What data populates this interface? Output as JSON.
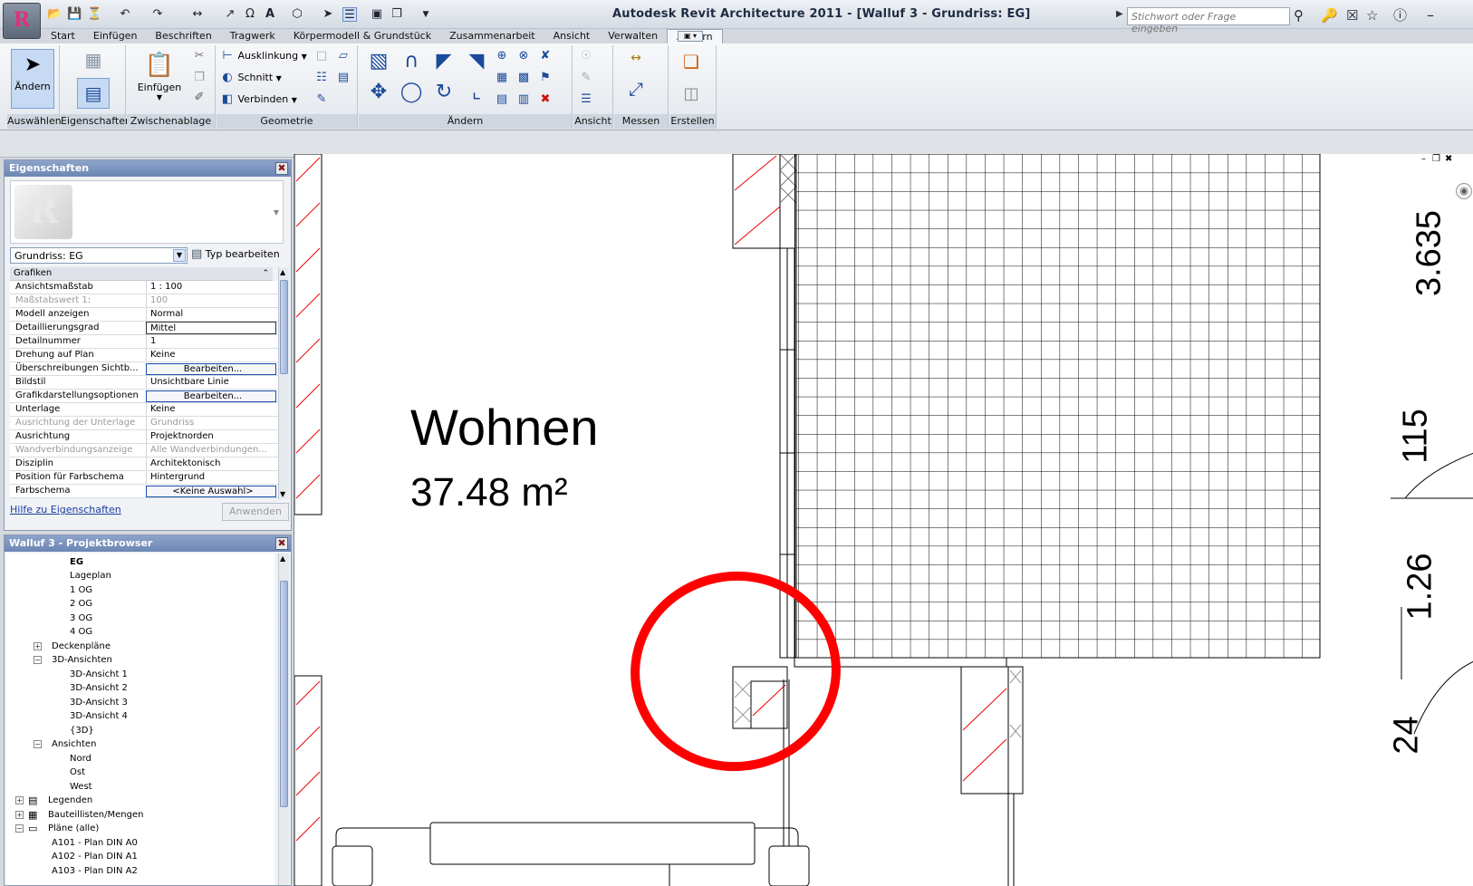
{
  "app": {
    "logo": "R",
    "title": "Autodesk Revit Architecture 2011 - [Walluf 3 - Grundriss: EG]",
    "search_placeholder": "Stichwort oder Frage eingeben"
  },
  "tabs": [
    "Start",
    "Einfügen",
    "Beschriften",
    "Tragwerk",
    "Körpermodell & Grundstück",
    "Zusammenarbeit",
    "Ansicht",
    "Verwalten",
    "Ändern"
  ],
  "ribbon": {
    "panels": [
      "Auswählen",
      "Eigenschaften",
      "Zwischenablage",
      "Geometrie",
      "Ändern",
      "Ansicht",
      "Messen",
      "Erstellen"
    ],
    "aendern_button": "Ändern",
    "einfuegen_button": "Einfügen",
    "geometrie_items": [
      "Ausklinkung",
      "Schnitt",
      "Verbinden"
    ]
  },
  "properties": {
    "title": "Eigenschaften",
    "type_selector": "Grundriss: EG",
    "edit_type": "Typ bearbeiten",
    "group": "Grafiken",
    "rows": [
      {
        "name": "Ansichtsmaßstab",
        "value": "1 : 100"
      },
      {
        "name": "Maßstabswert 1:",
        "value": "100"
      },
      {
        "name": "Modell anzeigen",
        "value": "Normal"
      },
      {
        "name": "Detaillierungsgrad",
        "value": "Mittel"
      },
      {
        "name": "Detailnummer",
        "value": "1"
      },
      {
        "name": "Drehung auf Plan",
        "value": "Keine"
      },
      {
        "name": "Überschreibungen Sichtb...",
        "value": "Bearbeiten..."
      },
      {
        "name": "Bildstil",
        "value": "Unsichtbare Linie"
      },
      {
        "name": "Grafikdarstellungsoptionen",
        "value": "Bearbeiten..."
      },
      {
        "name": "Unterlage",
        "value": "Keine"
      },
      {
        "name": "Ausrichtung der Unterlage",
        "value": "Grundriss"
      },
      {
        "name": "Ausrichtung",
        "value": "Projektnorden"
      },
      {
        "name": "Wandverbindungsanzeige",
        "value": "Alle Wandverbindungen..."
      },
      {
        "name": "Disziplin",
        "value": "Architektonisch"
      },
      {
        "name": "Position für Farbschema",
        "value": "Hintergrund"
      },
      {
        "name": "Farbschema",
        "value": "<Keine Auswahl>"
      }
    ],
    "help_link": "Hilfe zu Eigenschaften",
    "apply": "Anwenden"
  },
  "browser": {
    "title": "Walluf 3 - Projektbrowser",
    "items": [
      "EG",
      "Lageplan",
      "1 OG",
      "2 OG",
      "3 OG",
      "4 OG",
      "Deckenpläne",
      "3D-Ansichten",
      "3D-Ansicht 1",
      "3D-Ansicht 2",
      "3D-Ansicht 3",
      "3D-Ansicht 4",
      "{3D}",
      "Ansichten",
      "Nord",
      "Ost",
      "West",
      "Legenden",
      "Bauteillisten/Mengen",
      "Pläne (alle)",
      "A101 - Plan DIN A0",
      "A102 - Plan DIN A1",
      "A103 - Plan DIN A2"
    ]
  },
  "drawing": {
    "room_name": "Wohnen",
    "room_area": "37.48 m²",
    "dims": [
      "3.635",
      "115",
      "1.26",
      "24"
    ]
  }
}
